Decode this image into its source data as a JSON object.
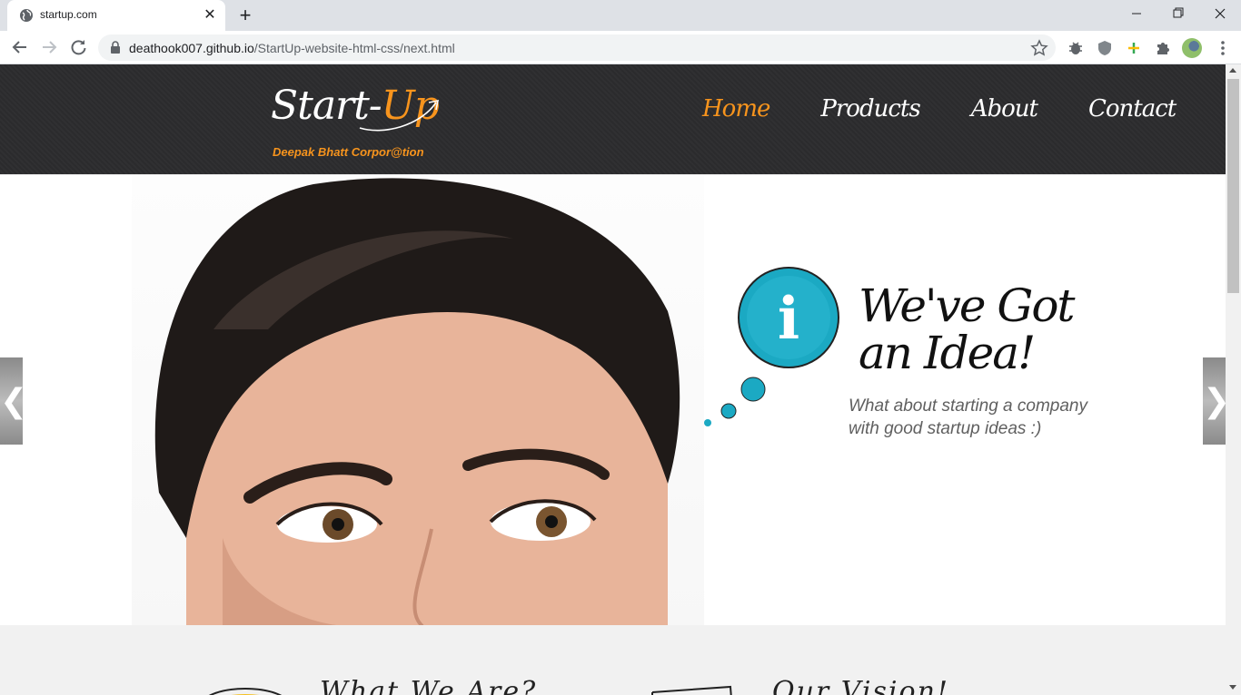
{
  "browser": {
    "tab_title": "startup.com",
    "tab_close": "✕",
    "new_tab": "+",
    "url_host": "deathook007.github.io",
    "url_path": "/StartUp-website-html-css/next.html",
    "window_min": "–",
    "window_max": "❐",
    "window_close": "✕"
  },
  "site": {
    "logo_start": "Start-",
    "logo_up": "Up",
    "tagline": "Deepak Bhatt Corpor@tion",
    "nav": [
      {
        "label": "Home",
        "active": true
      },
      {
        "label": "Products",
        "active": false
      },
      {
        "label": "About",
        "active": false
      },
      {
        "label": "Contact",
        "active": false
      }
    ],
    "accent_color": "#f7941d",
    "header_bg": "#2d2d2f"
  },
  "hero": {
    "bubble_letter": "i",
    "title_line1": "We've Got",
    "title_line2": "an Idea!",
    "subtitle_line1": "What about starting a company",
    "subtitle_line2": "with good startup ideas :)",
    "arrow_left": "❮",
    "arrow_right": "❯",
    "bubble_color": "#1ba9c3"
  },
  "section2": {
    "title1": "What We Are?",
    "title2": "Our Vision!"
  },
  "icons": [
    "globe-icon",
    "back-arrow-icon",
    "forward-arrow-icon",
    "reload-icon",
    "lock-icon",
    "star-icon",
    "bug-extension-icon",
    "shield-extension-icon",
    "plus-extension-icon",
    "puzzle-extensions-icon",
    "kebab-menu-icon"
  ]
}
